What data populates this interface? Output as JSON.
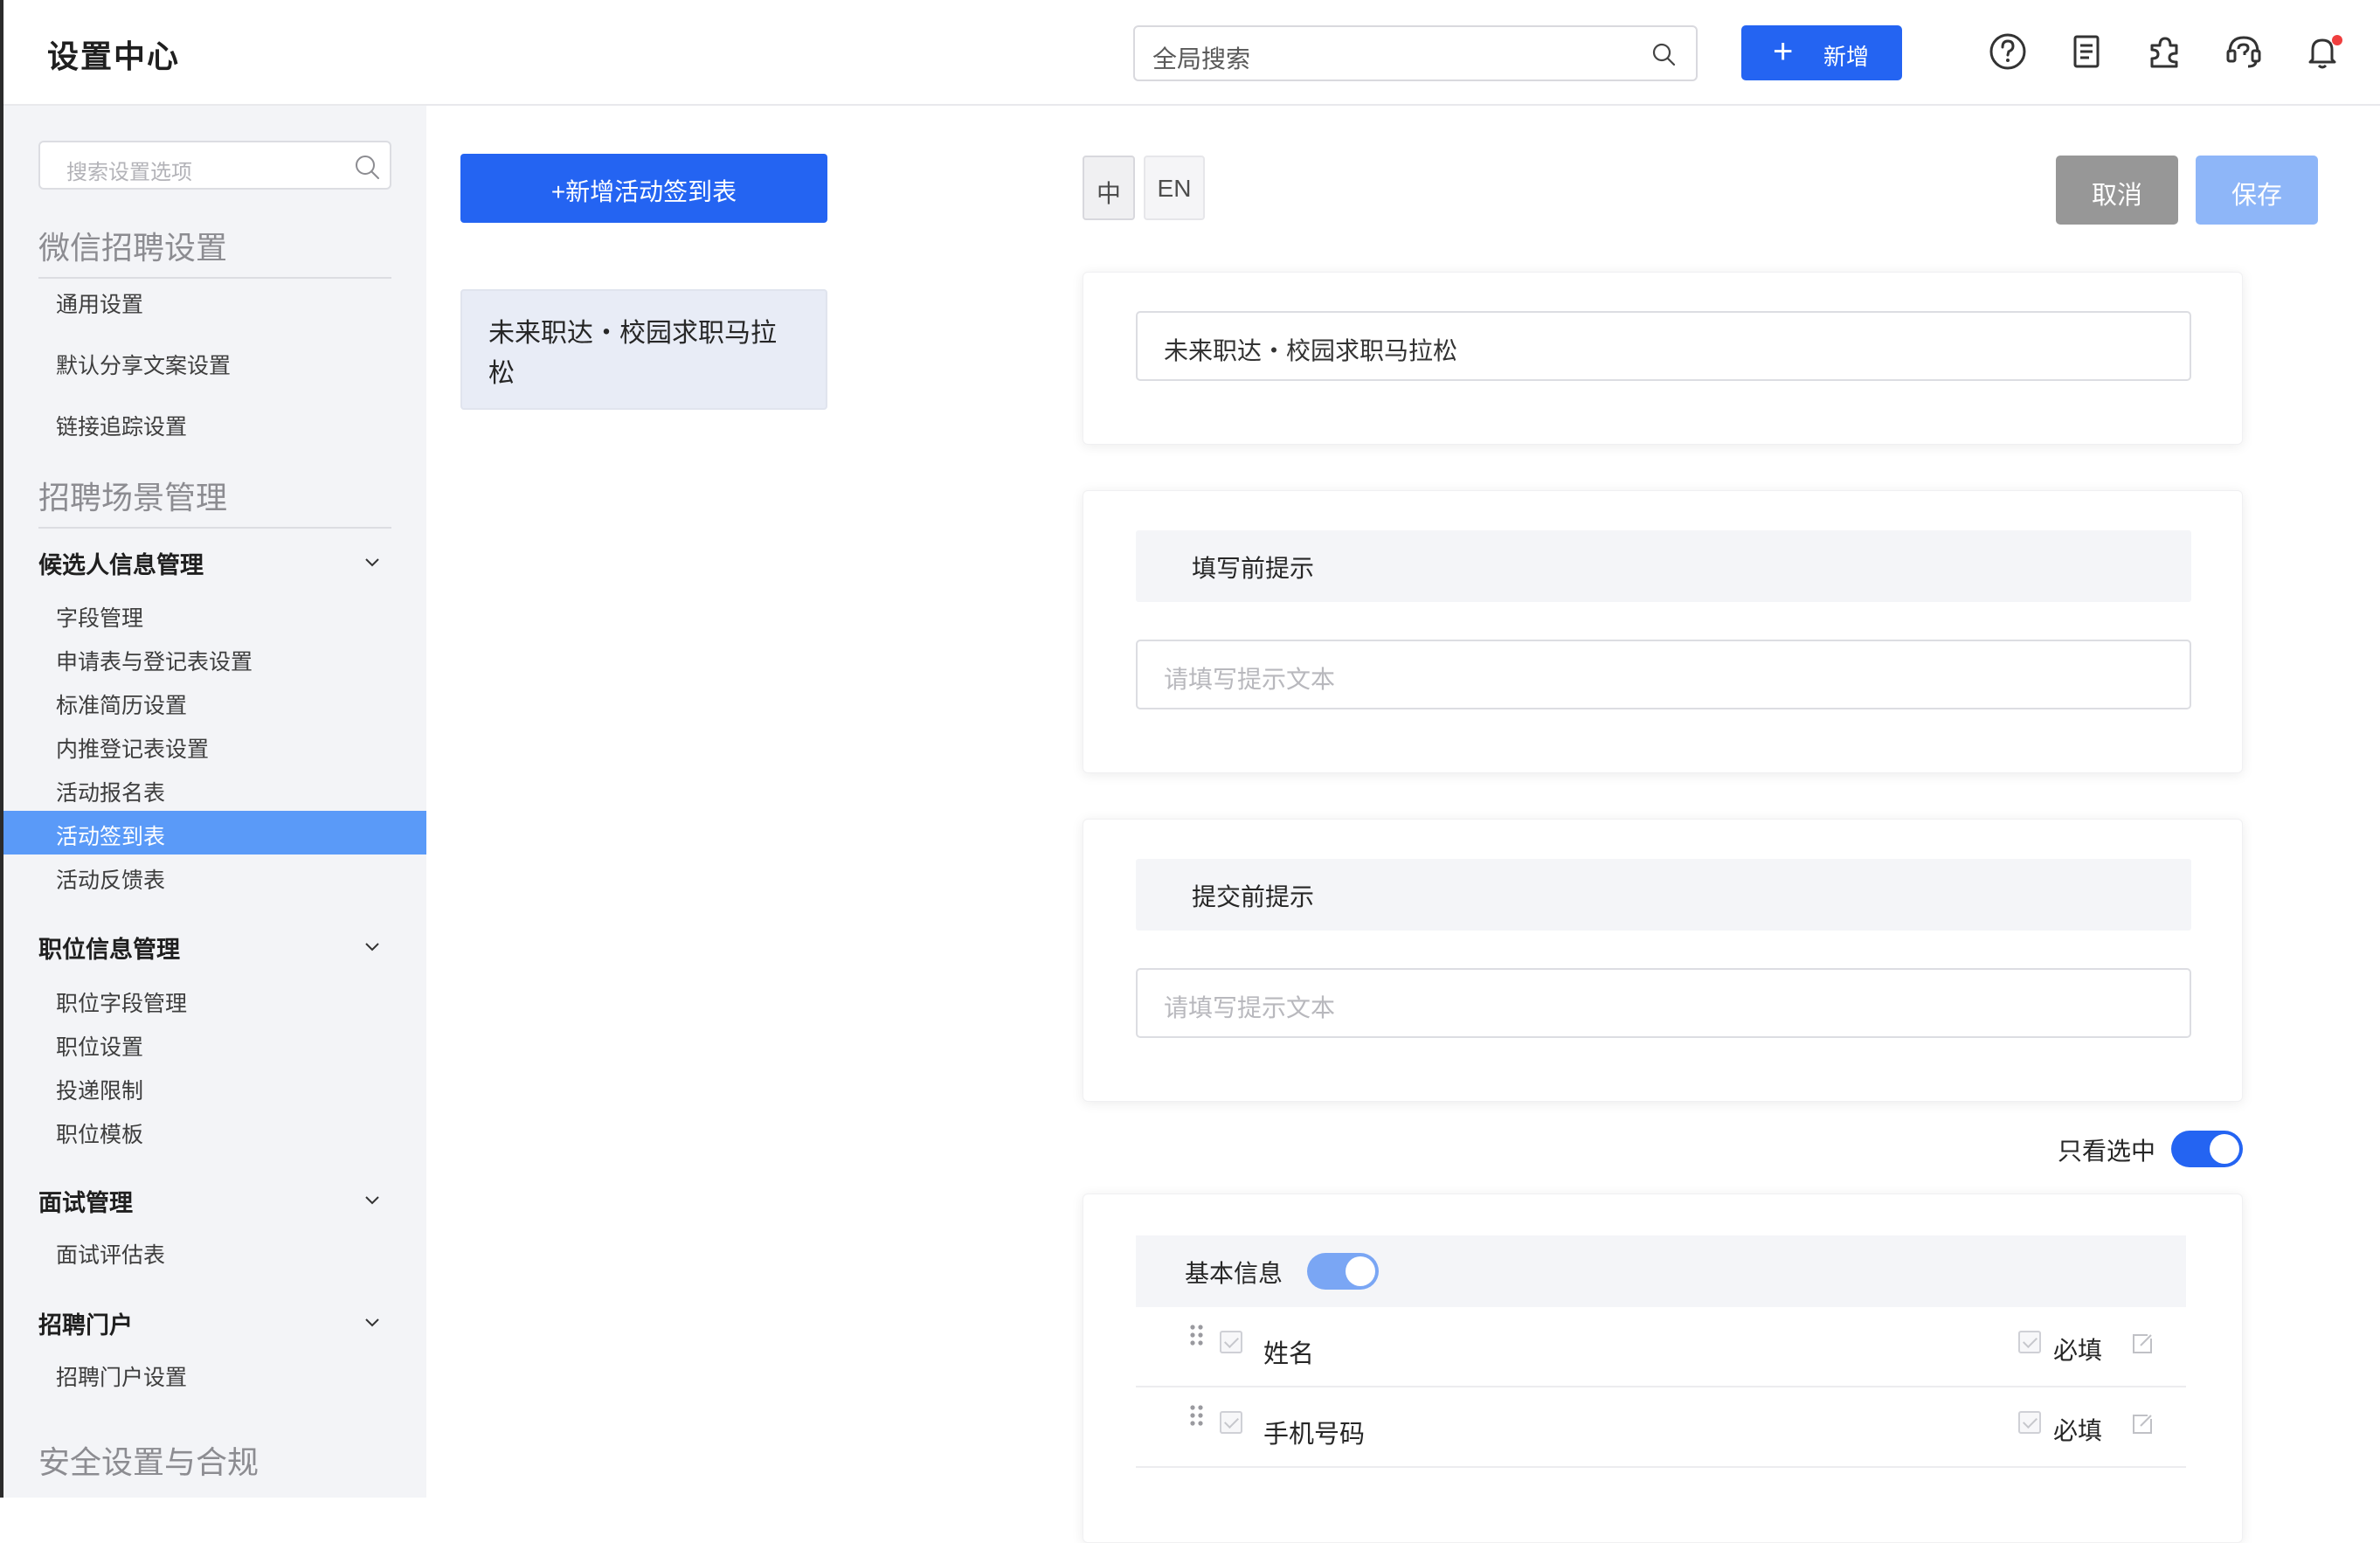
{
  "header": {
    "title": "设置中心",
    "search_placeholder": "全局搜索",
    "add_label": "新增",
    "icons": [
      "help-circle-icon",
      "document-icon",
      "plugin-icon",
      "support-icon",
      "bell-icon"
    ]
  },
  "sidebar": {
    "search_placeholder": "搜索设置选项",
    "group1": {
      "title": "微信招聘设置",
      "items": [
        "通用设置",
        "默认分享文案设置",
        "链接追踪设置"
      ]
    },
    "group2": {
      "title": "招聘场景管理"
    },
    "sections": [
      {
        "title": "候选人信息管理",
        "items": [
          "字段管理",
          "申请表与登记表设置",
          "标准简历设置",
          "内推登记表设置",
          "活动报名表",
          "活动签到表",
          "活动反馈表"
        ]
      },
      {
        "title": "职位信息管理",
        "items": [
          "职位字段管理",
          "职位设置",
          "投递限制",
          "职位模板"
        ]
      },
      {
        "title": "面试管理",
        "items": [
          "面试评估表"
        ]
      },
      {
        "title": "招聘门户",
        "items": [
          "招聘门户设置"
        ]
      }
    ],
    "active_item": "活动签到表",
    "group3": {
      "title": "安全设置与合规"
    }
  },
  "forms": {
    "add_button": "+新增活动签到表",
    "list": [
      "未来职达・校园求职马拉松"
    ]
  },
  "editor": {
    "lang": [
      "中",
      "EN"
    ],
    "cancel": "取消",
    "save": "保存",
    "form_name": "未来职达・校园求职马拉松",
    "pre_fill_title": "填写前提示",
    "pre_fill_placeholder": "请填写提示文本",
    "pre_submit_title": "提交前提示",
    "pre_submit_placeholder": "请填写提示文本",
    "only_selected_label": "只看选中",
    "only_selected_on": true,
    "field_group": {
      "title": "基本信息",
      "enabled": true
    },
    "fields": [
      {
        "name": "姓名",
        "required_label": "必填"
      },
      {
        "name": "手机号码",
        "required_label": "必填"
      }
    ]
  },
  "colors": {
    "primary": "#2464f2",
    "active_nav": "#5a9af8",
    "cancel": "#979797",
    "save_disabled": "#8eb6f8"
  }
}
